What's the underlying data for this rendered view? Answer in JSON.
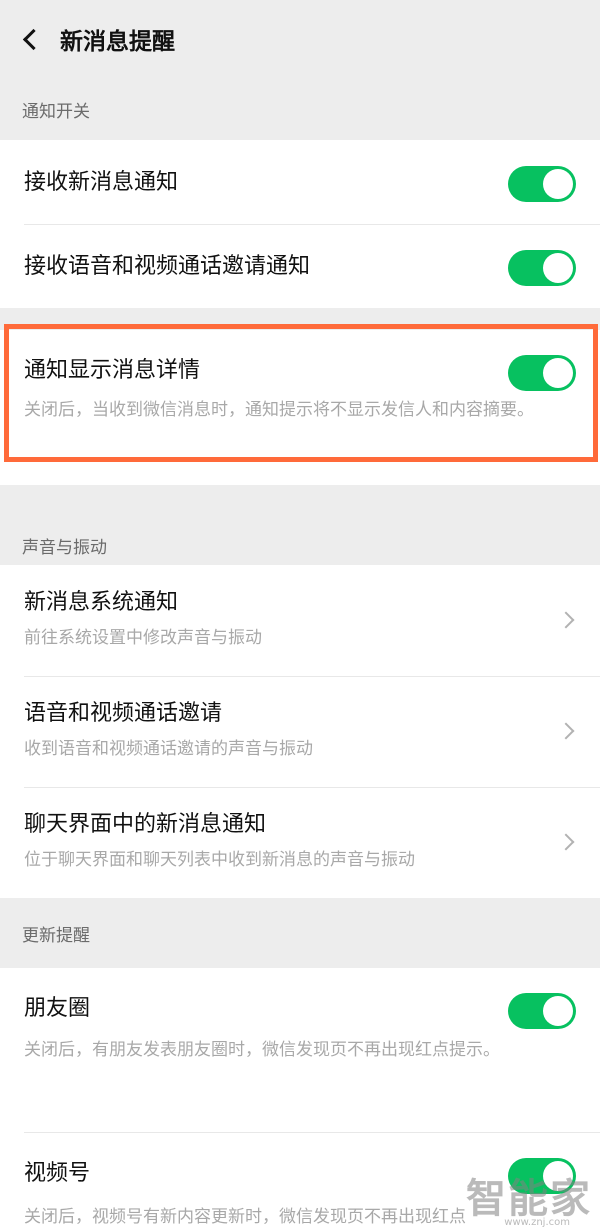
{
  "header": {
    "title": "新消息提醒"
  },
  "sections": {
    "notify_switch": {
      "label": "通知开关",
      "receive_new": {
        "title": "接收新消息通知",
        "enabled": true
      },
      "receive_call": {
        "title": "接收语音和视频通话邀请通知",
        "enabled": true
      },
      "show_details": {
        "title": "通知显示消息详情",
        "subtitle": "关闭后，当收到微信消息时，通知提示将不显示发信人和内容摘要。",
        "enabled": true
      }
    },
    "sound": {
      "label": "声音与振动",
      "system": {
        "title": "新消息系统通知",
        "subtitle": "前往系统设置中修改声音与振动"
      },
      "call": {
        "title": "语音和视频通话邀请",
        "subtitle": "收到语音和视频通话邀请的声音与振动"
      },
      "chat": {
        "title": "聊天界面中的新消息通知",
        "subtitle": "位于聊天界面和聊天列表中收到新消息的声音与振动"
      }
    },
    "updates": {
      "label": "更新提醒",
      "moments": {
        "title": "朋友圈",
        "subtitle": "关闭后，有朋友发表朋友圈时，微信发现页不再出现红点提示。",
        "enabled": true
      },
      "channels": {
        "title": "视频号",
        "subtitle": "关闭后，视频号有新内容更新时，微信发现页不再出现红点",
        "enabled": true
      }
    }
  },
  "watermark": {
    "text": "智能家",
    "url": "www.znj.com"
  },
  "colors": {
    "toggle_on": "#07c160",
    "highlight": "#ff6a3a",
    "background": "#ededed"
  }
}
